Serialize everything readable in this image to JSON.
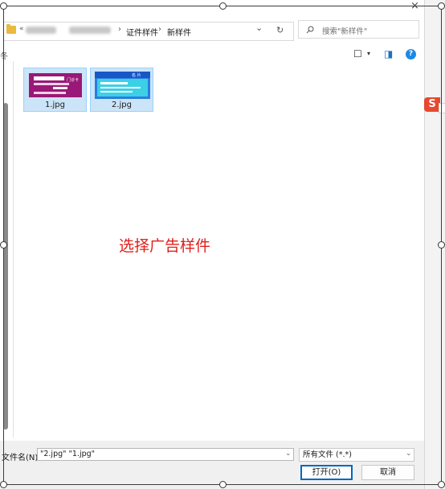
{
  "window": {
    "close_glyph": "×"
  },
  "address_bar": {
    "breadcrumb": [
      "证件样件",
      "新样件"
    ],
    "prefix": "«",
    "separator": "›",
    "dropdown_glyph": "⌄",
    "refresh_glyph": "↻"
  },
  "search": {
    "placeholder": "搜索\"新样件\"",
    "icon": "search-icon"
  },
  "toolbar": {
    "left_fragment": "冬",
    "view_glyph": "☐",
    "view_dropdown_glyph": "▾",
    "preview_pane_glyph": "◨",
    "help_glyph": "?"
  },
  "files": [
    {
      "name": "1.jpg",
      "selected": true,
      "thumb_color": "#9a1877",
      "thumb_tag": "门诊卡"
    },
    {
      "name": "2.jpg",
      "selected": true,
      "thumb_color": "#2a7de0",
      "thumb_tag": "名 片"
    }
  ],
  "annotation": {
    "text": "选择广告样件",
    "color": "#e0201c"
  },
  "filename": {
    "label": "文件名(N):",
    "value": "\"2.jpg\" \"1.jpg\"",
    "dropdown_glyph": "⌄"
  },
  "filetype": {
    "value": "所有文件 (*.*)",
    "dropdown_glyph": "⌄"
  },
  "buttons": {
    "open": "打开(O)",
    "cancel": "取消"
  },
  "side_badge": {
    "text": "S",
    "color": "#e8482f"
  }
}
